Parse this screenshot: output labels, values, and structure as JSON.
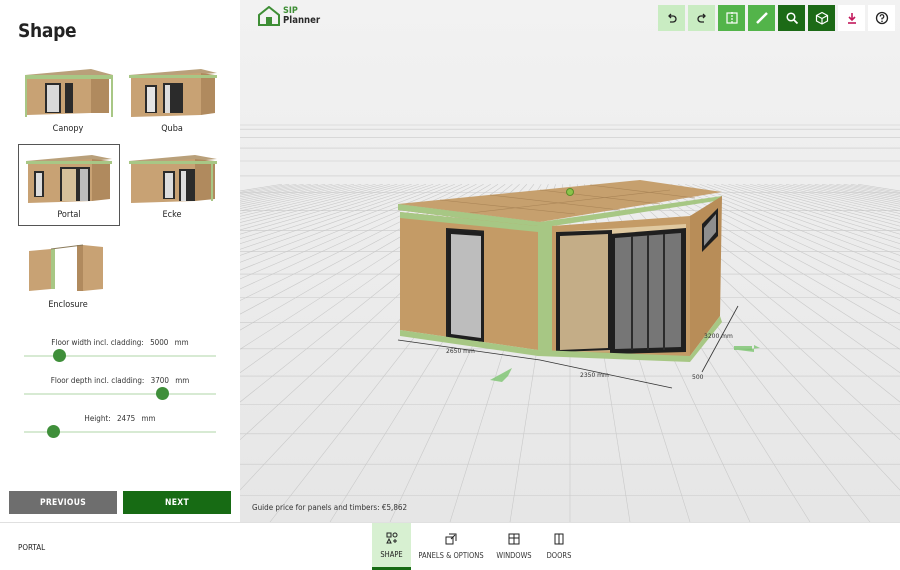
{
  "sidebar": {
    "title": "Shape",
    "shapes": [
      {
        "label": "Canopy"
      },
      {
        "label": "Quba"
      },
      {
        "label": "Portal"
      },
      {
        "label": "Ecke"
      },
      {
        "label": "Enclosure"
      }
    ],
    "selected_shape": "Portal",
    "sliders": [
      {
        "label": "Floor width incl. cladding:",
        "value": "5000",
        "unit": "mm",
        "level": 0.18
      },
      {
        "label": "Floor depth incl. cladding:",
        "value": "3700",
        "unit": "mm",
        "level": 0.72
      },
      {
        "label": "Height:",
        "value": "2475",
        "unit": "mm",
        "level": 0.15
      }
    ],
    "previous_label": "PREVIOUS",
    "next_label": "NEXT"
  },
  "viewport": {
    "logo": {
      "line1": "SIP",
      "line2": "Planner"
    },
    "toolbar": [
      {
        "icon": "undo-icon"
      },
      {
        "icon": "redo-icon"
      },
      {
        "icon": "mirror-icon"
      },
      {
        "icon": "measure-icon"
      },
      {
        "icon": "zoom-icon"
      },
      {
        "icon": "3d-view-icon"
      },
      {
        "icon": "download-icon"
      },
      {
        "icon": "help-icon"
      }
    ],
    "dimensions": {
      "left_width": "2650 mm",
      "right_width": "2350 mm",
      "depth": "3200 mm",
      "small": "500"
    },
    "guide_price": "Guide price for panels and timbers: €5,862"
  },
  "bottombar": {
    "current_shape": "PORTAL",
    "tabs": [
      {
        "label": "SHAPE",
        "icon": "shapes-icon",
        "active": true
      },
      {
        "label": "PANELS & OPTIONS",
        "icon": "panels-icon",
        "active": false
      },
      {
        "label": "WINDOWS",
        "icon": "window-icon",
        "active": false
      },
      {
        "label": "DOORS",
        "icon": "door-icon",
        "active": false
      }
    ]
  },
  "colors": {
    "brand_dark": "#176b14",
    "brand_mid": "#53b44a",
    "brand_light": "#c9ecc2",
    "osb": "#c8a274",
    "grey_button": "#6e6e6e"
  }
}
